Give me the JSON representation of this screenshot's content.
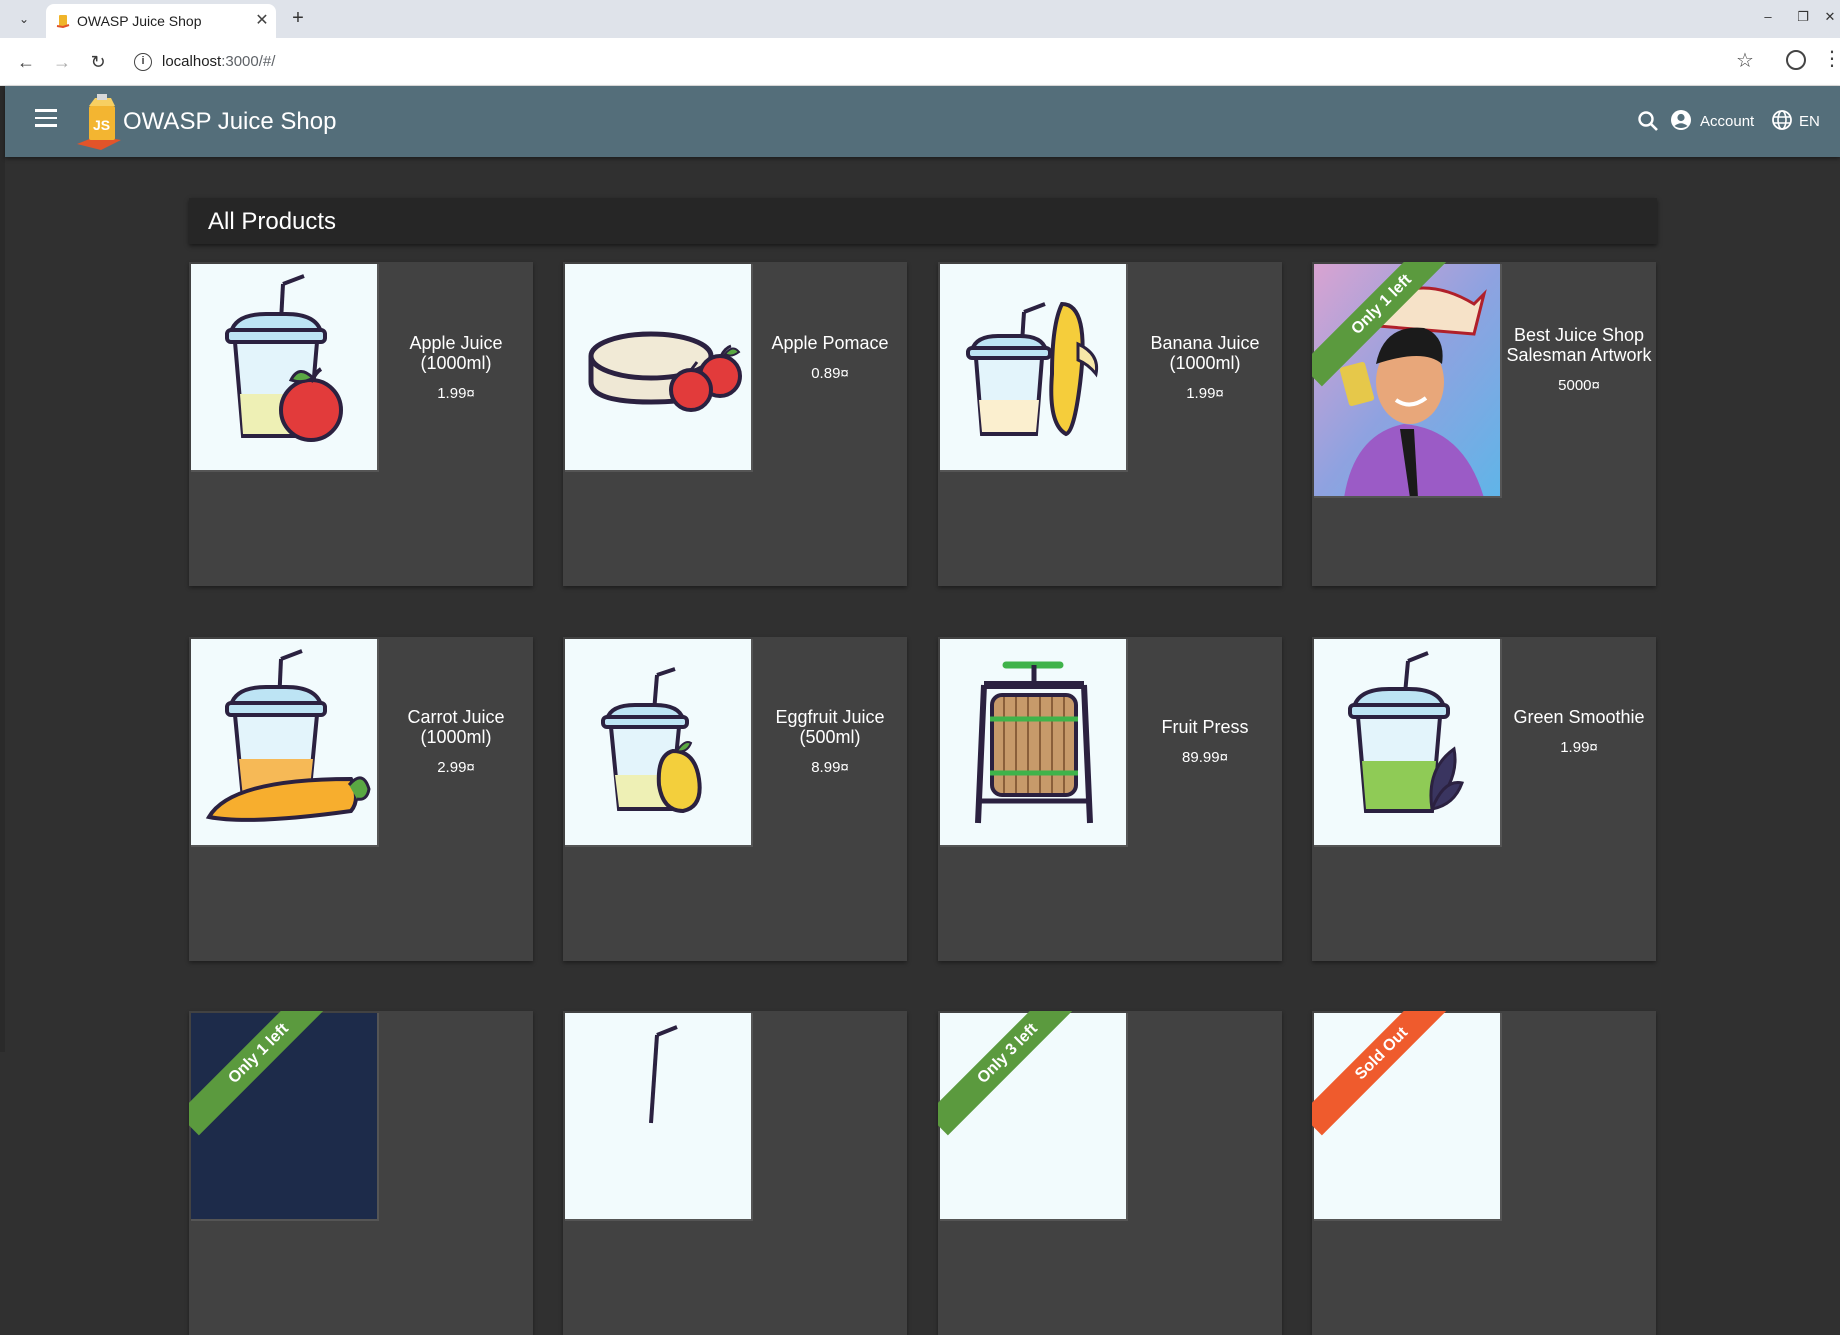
{
  "browser": {
    "tab_title": "OWASP Juice Shop",
    "new_tab": "+",
    "url_host": "localhost",
    "url_rest": ":3000/#/",
    "minimize": "–",
    "restore": "❐",
    "close": "✕"
  },
  "app": {
    "title": "OWASP Juice Shop",
    "account_label": "Account",
    "language_label": "EN",
    "colors": {
      "toolbar": "#546e7a",
      "background": "#303030",
      "card": "#424242",
      "ribbon_green": "#5b9a3e",
      "ribbon_orange": "#ef5b2d"
    }
  },
  "main": {
    "heading": "All Products",
    "products": [
      {
        "name": "Apple Juice (1000ml)",
        "price": "1.99¤",
        "icon": "apple-juice-icon"
      },
      {
        "name": "Apple Pomace",
        "price": "0.89¤",
        "icon": "apple-pomace-icon"
      },
      {
        "name": "Banana Juice (1000ml)",
        "price": "1.99¤",
        "icon": "banana-juice-icon"
      },
      {
        "name": "Best Juice Shop Salesman Artwork",
        "price": "5000¤",
        "icon": "salesman-artwork-image",
        "badge": "Only 1 left"
      },
      {
        "name": "Carrot Juice (1000ml)",
        "price": "2.99¤",
        "icon": "carrot-juice-icon"
      },
      {
        "name": "Eggfruit Juice (500ml)",
        "price": "8.99¤",
        "icon": "eggfruit-juice-icon"
      },
      {
        "name": "Fruit Press",
        "price": "89.99¤",
        "icon": "fruit-press-icon"
      },
      {
        "name": "Green Smoothie",
        "price": "1.99¤",
        "icon": "green-smoothie-icon"
      }
    ],
    "partial_row": [
      {
        "badge": "Only 1 left",
        "icon": "hat-image"
      },
      {
        "icon": "juice-cup-icon"
      },
      {
        "badge": "Only 3 left",
        "icon": "product-image"
      },
      {
        "badge": "Sold Out",
        "icon": "product-image"
      }
    ]
  }
}
